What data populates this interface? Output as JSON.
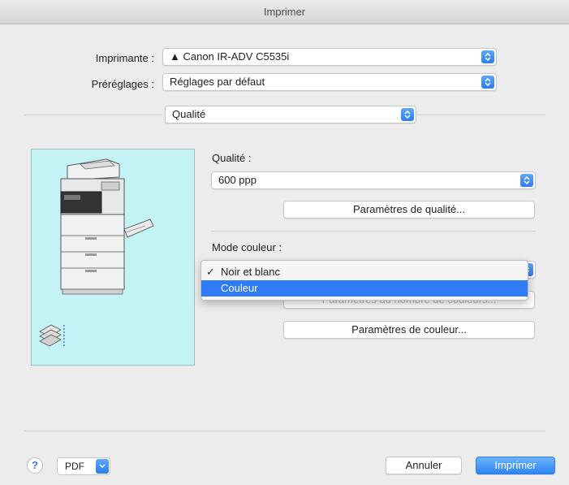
{
  "window": {
    "title": "Imprimer"
  },
  "printer": {
    "label": "Imprimante :",
    "value": "▲ Canon IR-ADV C5535i"
  },
  "presets": {
    "label": "Préréglages :",
    "value": "Réglages par défaut"
  },
  "pane": {
    "value": "Qualité"
  },
  "quality": {
    "label": "Qualité :",
    "value": "600 ppp",
    "settings_button": "Paramètres de qualité..."
  },
  "color_mode": {
    "label": "Mode couleur :",
    "options": [
      "Noir et blanc",
      "Couleur"
    ],
    "checked": "Noir et blanc",
    "highlighted": "Couleur",
    "hidden_button": "Paramètres du nombre de couleurs...",
    "color_settings_button": "Paramètres de couleur..."
  },
  "footer": {
    "help": "?",
    "pdf": "PDF",
    "cancel": "Annuler",
    "print": "Imprimer"
  },
  "colors": {
    "accent": "#2f7cf6",
    "preview_bg": "#c3f3f5"
  }
}
